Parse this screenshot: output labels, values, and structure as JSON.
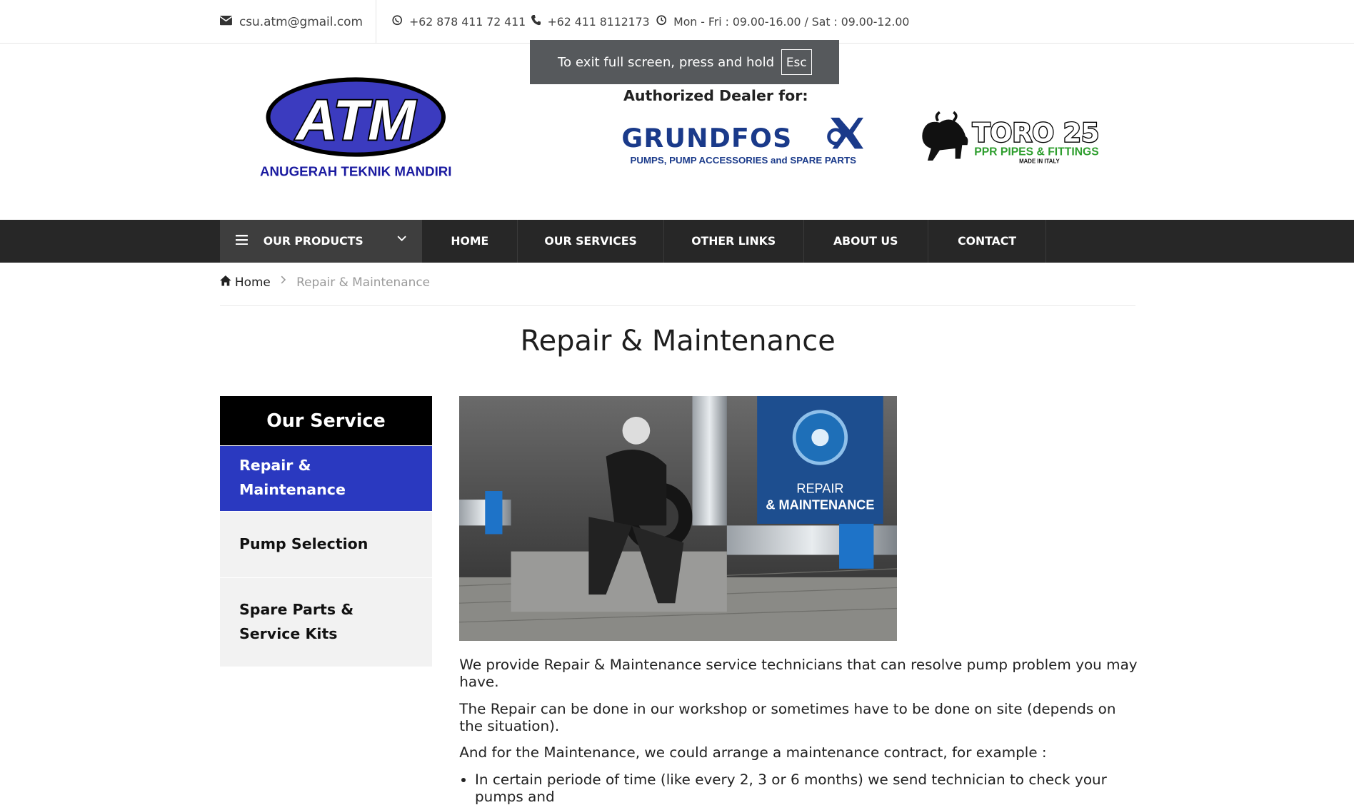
{
  "topbar": {
    "email": "csu.atm@gmail.com",
    "whatsapp": "+62 878 411 72 411",
    "phone": "+62 411 8112173",
    "hours": "Mon - Fri : 09.00-16.00 / Sat : 09.00-12.00"
  },
  "fullscreen_notice": {
    "text": "To exit full screen, press and hold",
    "key": "Esc"
  },
  "header": {
    "logo_text": "ATM",
    "company_name": "ANUGERAH TEKNIK MANDIRI",
    "dealer_label": "Authorized Dealer for:",
    "grundfos_name": "GRUNDFOS",
    "grundfos_tagline": "PUMPS, PUMP ACCESSORIES and SPARE PARTS",
    "toro_name": "TORO 25",
    "toro_tagline": "PPR PIPES & FITTINGS",
    "toro_made": "MADE IN ITALY"
  },
  "nav": {
    "products": "OUR PRODUCTS",
    "links": [
      "HOME",
      "OUR SERVICES",
      "OTHER LINKS",
      "ABOUT US",
      "CONTACT"
    ]
  },
  "breadcrumb": {
    "home": "Home",
    "current": "Repair & Maintenance"
  },
  "page_title": "Repair & Maintenance",
  "sidebar": {
    "title": "Our Service",
    "items": [
      "Repair & Maintenance",
      "Pump Selection",
      "Spare Parts & Service Kits"
    ]
  },
  "photo": {
    "badge_line1": "REPAIR",
    "badge_line2": "& MAINTENANCE"
  },
  "content": {
    "p1": "We provide Repair & Maintenance service technicians that can resolve pump problem you may have.",
    "p2": "The Repair can be done in our workshop or sometimes have to be done on site (depends on the situation).",
    "p3": "And for the Maintenance, we could arrange a maintenance contract, for example :",
    "li1": "In certain periode of time (like every 2, 3 or 6 months) we send technician to check your pumps and"
  },
  "colors": {
    "accent": "#2a39c0",
    "nav_bg": "#272727",
    "grundfos_blue": "#1a3a8a",
    "toro_green": "#2e9e2e"
  }
}
